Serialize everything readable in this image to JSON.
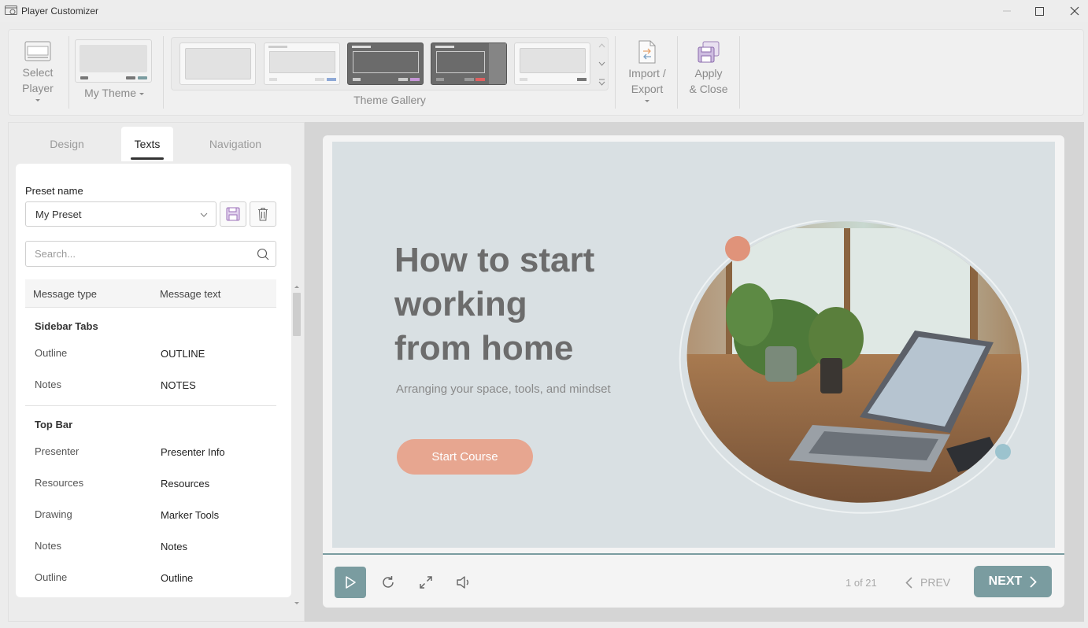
{
  "window": {
    "title": "Player Customizer",
    "icons": {
      "app": "player-customizer-icon",
      "minimize": "minimize-icon",
      "maximize": "maximize-icon",
      "close": "close-icon"
    }
  },
  "ribbon": {
    "select_player": {
      "line1": "Select",
      "line2": "Player",
      "icon": "player-icon"
    },
    "my_theme": {
      "label": "My Theme"
    },
    "theme_gallery": {
      "label": "Theme Gallery"
    },
    "import_export": {
      "line1": "Import /",
      "line2": "Export",
      "icon": "document-swap-icon"
    },
    "apply_close": {
      "line1": "Apply",
      "line2": "& Close",
      "icon": "save-close-icon"
    }
  },
  "left_panel": {
    "tabs": [
      {
        "label": "Design",
        "active": false
      },
      {
        "label": "Texts",
        "active": true
      },
      {
        "label": "Navigation",
        "active": false
      }
    ],
    "preset": {
      "label": "Preset name",
      "value": "My Preset",
      "save_icon": "save-icon",
      "delete_icon": "trash-icon"
    },
    "search": {
      "placeholder": "Search..."
    },
    "table": {
      "headers": [
        "Message type",
        "Message text"
      ],
      "groups": [
        {
          "title": "Sidebar Tabs",
          "rows": [
            {
              "type": "Outline",
              "text": "OUTLINE"
            },
            {
              "type": "Notes",
              "text": "NOTES"
            }
          ]
        },
        {
          "title": "Top Bar",
          "rows": [
            {
              "type": "Presenter",
              "text": "Presenter Info"
            },
            {
              "type": "Resources",
              "text": "Resources"
            },
            {
              "type": "Drawing",
              "text": "Marker Tools"
            },
            {
              "type": "Notes",
              "text": "Notes"
            },
            {
              "type": "Outline",
              "text": "Outline"
            }
          ]
        }
      ]
    }
  },
  "preview": {
    "slide": {
      "title_lines": [
        "How to start",
        "working",
        "from home"
      ],
      "subtitle": "Arranging your space, tools, and mindset",
      "button": "Start Course",
      "image": "desk-laptop-plants-photo"
    },
    "controls": {
      "page": "1 of 21",
      "prev": "PREV",
      "next": "NEXT",
      "icons": [
        "play-icon",
        "replay-icon",
        "fullscreen-icon",
        "volume-icon"
      ]
    },
    "colors": {
      "accent": "#7a9ca0",
      "button": "#e7a690",
      "slide_bg": "#d9e0e3"
    }
  }
}
